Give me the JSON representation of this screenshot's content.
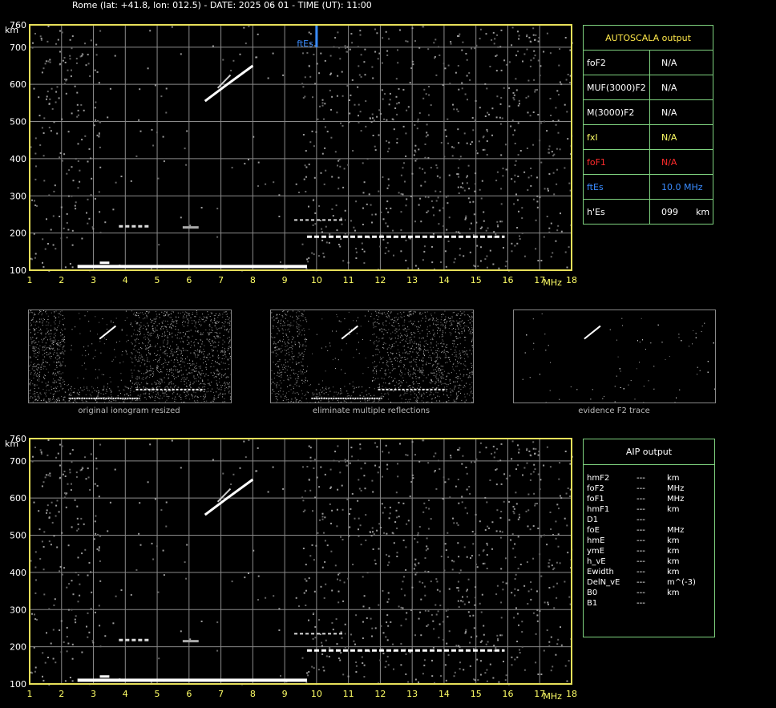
{
  "header": {
    "title": "Rome (lat: +41.8, lon: 012.5) - DATE: 2025 06 01 - TIME (UT): 11:00"
  },
  "colors": {
    "frame": "#e8e05a",
    "grid": "#8a8a8a",
    "axis_label": "#ffff66",
    "table_border": "#7fd27f",
    "fEs": "#3a8cff",
    "foF1": "#ff2b2b",
    "fxI": "#ffff66"
  },
  "chart_data": [
    {
      "type": "scatter",
      "name": "top-ionogram",
      "xlabel": "MHz",
      "ylabel": "km",
      "xlim": [
        1,
        18
      ],
      "ylim": [
        100,
        760
      ],
      "x_ticks": [
        "1",
        "2",
        "3",
        "4",
        "5",
        "6",
        "7",
        "8",
        "9",
        "10",
        "11",
        "12",
        "13",
        "14",
        "15",
        "16",
        "17",
        "18"
      ],
      "y_ticks": [
        "100",
        "200",
        "300",
        "400",
        "500",
        "600",
        "700",
        "760"
      ],
      "grid": true,
      "marker": {
        "label": "ftEs",
        "x": 10.0
      },
      "traces": [
        {
          "label": "E/Es low trace",
          "x_from": 2.5,
          "x_to": 9.7,
          "y": 110
        },
        {
          "label": "Es trace",
          "x_from": 9.7,
          "x_to": 15.9,
          "y": 190
        },
        {
          "label": "F trace",
          "x_from": 3.8,
          "x_to": 4.8,
          "y": 218
        },
        {
          "label": "2nd-hop",
          "x_from": 6.6,
          "x_to": 8.0,
          "y_from": 555,
          "y_to": 650
        }
      ]
    },
    {
      "type": "scatter",
      "name": "bottom-ionogram",
      "xlabel": "MHz",
      "ylabel": "km",
      "xlim": [
        1,
        18
      ],
      "ylim": [
        100,
        760
      ],
      "x_ticks": [
        "1",
        "2",
        "3",
        "4",
        "5",
        "6",
        "7",
        "8",
        "9",
        "10",
        "11",
        "12",
        "13",
        "14",
        "15",
        "16",
        "17",
        "18"
      ],
      "y_ticks": [
        "100",
        "200",
        "300",
        "400",
        "500",
        "600",
        "700",
        "760"
      ],
      "grid": true
    }
  ],
  "autoscala": {
    "title": "AUTOSCALA output",
    "rows": [
      {
        "label": "foF2",
        "value": "N/A",
        "color": "#ffffff"
      },
      {
        "label": "MUF(3000)F2",
        "value": "N/A",
        "color": "#ffffff"
      },
      {
        "label": "M(3000)F2",
        "value": "N/A",
        "color": "#ffffff"
      },
      {
        "label": "fxI",
        "value": "N/A",
        "color": "#ffff66"
      },
      {
        "label": "foF1",
        "value": "N/A",
        "color": "#ff2b2b"
      },
      {
        "label": "ftEs",
        "value": "10.0 MHz",
        "color": "#3a8cff"
      },
      {
        "label": "h'Es",
        "value": "099",
        "unit": "km",
        "color": "#ffffff"
      }
    ]
  },
  "thumbnails": [
    {
      "caption": "original ionogram resized"
    },
    {
      "caption": "eliminate multiple reflections"
    },
    {
      "caption": "evidence F2 trace"
    }
  ],
  "aip": {
    "title": "AIP output",
    "rows": [
      {
        "label": "hmF2",
        "value": "---",
        "unit": "km"
      },
      {
        "label": "foF2",
        "value": "---",
        "unit": "MHz"
      },
      {
        "label": "foF1",
        "value": "---",
        "unit": "MHz"
      },
      {
        "label": "hmF1",
        "value": "---",
        "unit": "km"
      },
      {
        "label": "D1",
        "value": "---",
        "unit": ""
      },
      {
        "label": "foE",
        "value": "---",
        "unit": "MHz"
      },
      {
        "label": "hmE",
        "value": "---",
        "unit": "km"
      },
      {
        "label": "ymE",
        "value": "---",
        "unit": "km"
      },
      {
        "label": "h_vE",
        "value": "---",
        "unit": "km"
      },
      {
        "label": "Ewidth",
        "value": "---",
        "unit": "km"
      },
      {
        "label": "DelN_vE",
        "value": "---",
        "unit": "m^(-3)"
      },
      {
        "label": "B0",
        "value": "---",
        "unit": "km"
      },
      {
        "label": "B1",
        "value": "---",
        "unit": ""
      }
    ]
  }
}
